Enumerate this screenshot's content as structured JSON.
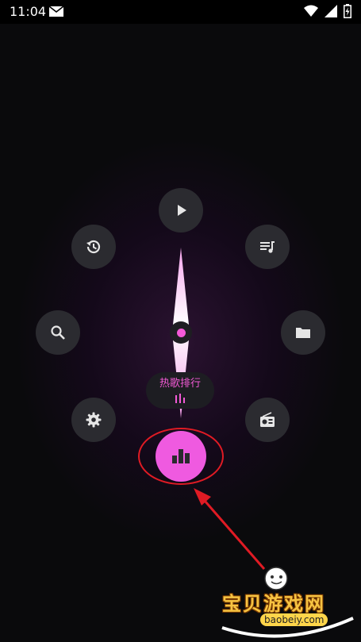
{
  "status_bar": {
    "time": "11:04",
    "icons": [
      "mail-icon",
      "wifi-icon",
      "signal-icon",
      "battery-charging-icon"
    ]
  },
  "radial_menu": {
    "buttons": [
      {
        "name": "play-button",
        "icon": "play-icon"
      },
      {
        "name": "history-button",
        "icon": "history-icon"
      },
      {
        "name": "queue-button",
        "icon": "queue-music-icon"
      },
      {
        "name": "search-button",
        "icon": "search-icon"
      },
      {
        "name": "folder-button",
        "icon": "folder-icon"
      },
      {
        "name": "settings-button",
        "icon": "gear-icon"
      },
      {
        "name": "radio-button",
        "icon": "radio-icon"
      }
    ],
    "selected": {
      "label": "热歌排行",
      "icon": "bar-chart-icon"
    }
  },
  "colors": {
    "accent": "#ef5ae0",
    "button_bg": "#2b2b30",
    "background": "#0a0a0c",
    "annotation": "#e01b24"
  },
  "watermark": {
    "title": "宝贝游戏网",
    "url": "baobeiy.com"
  }
}
